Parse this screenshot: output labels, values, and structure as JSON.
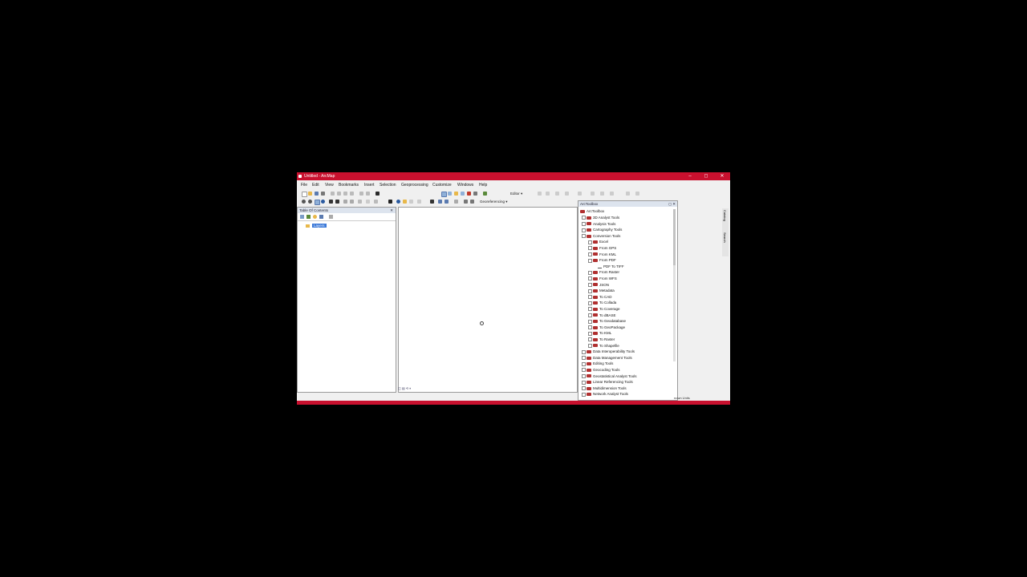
{
  "window": {
    "title": "Untitled - ArcMap",
    "minimize": "–",
    "maximize": "◻",
    "close": "✕"
  },
  "menu": [
    "File",
    "Edit",
    "View",
    "Bookmarks",
    "Insert",
    "Selection",
    "Geoprocessing",
    "Customize",
    "Windows",
    "Help"
  ],
  "toolbar": {
    "editor_label": "Editor ▾",
    "georef_label": "Georeferencing ▾"
  },
  "toc": {
    "title": "Table Of Contents",
    "pin": "⊓",
    "close": "✕",
    "layers_label": "Layers"
  },
  "toolbox": {
    "title": "ArcToolbox",
    "controls": "◻ ✕",
    "root": "ArcToolbox",
    "items": [
      {
        "label": "3D Analyst Tools",
        "level": 1,
        "kind": "toolbox",
        "expanded": false
      },
      {
        "label": "Analysis Tools",
        "level": 1,
        "kind": "toolbox",
        "expanded": false
      },
      {
        "label": "Cartography Tools",
        "level": 1,
        "kind": "toolbox",
        "expanded": false
      },
      {
        "label": "Conversion Tools",
        "level": 1,
        "kind": "toolbox",
        "expanded": true
      },
      {
        "label": "Excel",
        "level": 2,
        "kind": "toolset",
        "expanded": false
      },
      {
        "label": "From GPS",
        "level": 2,
        "kind": "toolset",
        "expanded": false
      },
      {
        "label": "From KML",
        "level": 2,
        "kind": "toolset",
        "expanded": false
      },
      {
        "label": "From PDF",
        "level": 2,
        "kind": "toolset",
        "expanded": true
      },
      {
        "label": "PDF To TIFF",
        "level": 3,
        "kind": "tool",
        "expanded": false
      },
      {
        "label": "From Raster",
        "level": 2,
        "kind": "toolset",
        "expanded": false
      },
      {
        "label": "From WFS",
        "level": 2,
        "kind": "toolset",
        "expanded": false
      },
      {
        "label": "JSON",
        "level": 2,
        "kind": "toolset",
        "expanded": false
      },
      {
        "label": "Metadata",
        "level": 2,
        "kind": "toolset",
        "expanded": false
      },
      {
        "label": "To CAD",
        "level": 2,
        "kind": "toolset",
        "expanded": false
      },
      {
        "label": "To Collada",
        "level": 2,
        "kind": "toolset",
        "expanded": false
      },
      {
        "label": "To Coverage",
        "level": 2,
        "kind": "toolset",
        "expanded": false
      },
      {
        "label": "To dBASE",
        "level": 2,
        "kind": "toolset",
        "expanded": false
      },
      {
        "label": "To Geodatabase",
        "level": 2,
        "kind": "toolset",
        "expanded": false
      },
      {
        "label": "To GeoPackage",
        "level": 2,
        "kind": "toolset",
        "expanded": false
      },
      {
        "label": "To KML",
        "level": 2,
        "kind": "toolset",
        "expanded": false
      },
      {
        "label": "To Raster",
        "level": 2,
        "kind": "toolset",
        "expanded": false
      },
      {
        "label": "To Shapefile",
        "level": 2,
        "kind": "toolset",
        "expanded": false
      },
      {
        "label": "Data Interoperability Tools",
        "level": 1,
        "kind": "toolbox",
        "expanded": false
      },
      {
        "label": "Data Management Tools",
        "level": 1,
        "kind": "toolbox",
        "expanded": false
      },
      {
        "label": "Editing Tools",
        "level": 1,
        "kind": "toolbox",
        "expanded": false
      },
      {
        "label": "Geocoding Tools",
        "level": 1,
        "kind": "toolbox",
        "expanded": false
      },
      {
        "label": "Geostatistical Analyst Tools",
        "level": 1,
        "kind": "toolbox",
        "expanded": false
      },
      {
        "label": "Linear Referencing Tools",
        "level": 1,
        "kind": "toolbox",
        "expanded": false
      },
      {
        "label": "Multidimension Tools",
        "level": 1,
        "kind": "toolbox",
        "expanded": false
      },
      {
        "label": "Network Analyst Tools",
        "level": 1,
        "kind": "toolbox",
        "expanded": false
      }
    ]
  },
  "side_tabs": [
    "Catalog",
    "Search"
  ],
  "status": {
    "units": "nown Units"
  }
}
